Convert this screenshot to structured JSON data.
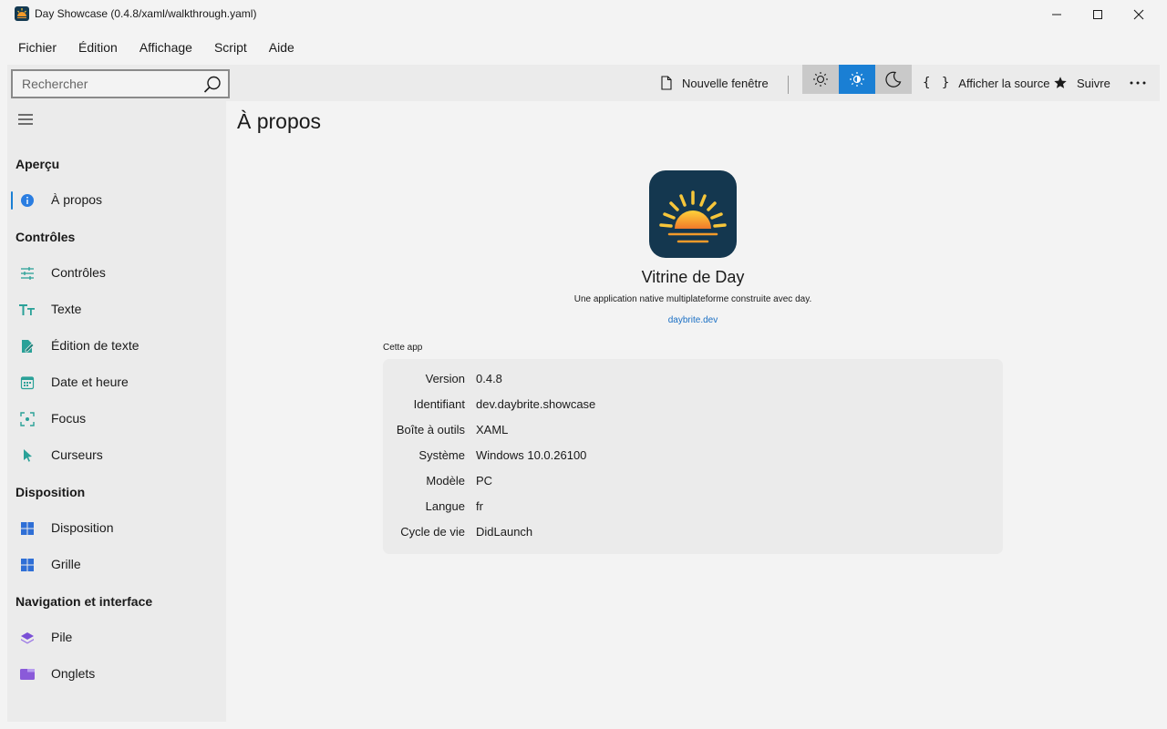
{
  "window": {
    "title": "Day Showcase (0.4.8/xaml/walkthrough.yaml)",
    "controls": [
      "minimize-icon",
      "maximize-icon",
      "close-icon"
    ]
  },
  "menu": [
    "Fichier",
    "Édition",
    "Affichage",
    "Script",
    "Aide"
  ],
  "toolbar": {
    "search_placeholder": "Rechercher",
    "new_window": "Nouvelle fenêtre",
    "view_source": "Afficher la source",
    "follow": "Suivre",
    "theme_selected": "auto",
    "accent": "#1a7fd4"
  },
  "sidebar": {
    "sections": [
      {
        "title": "Aperçu",
        "items": [
          {
            "label": "À propos",
            "icon": "info-icon",
            "selected": true
          }
        ]
      },
      {
        "title": "Contrôles",
        "items": [
          {
            "label": "Contrôles",
            "icon": "sliders-icon"
          },
          {
            "label": "Texte",
            "icon": "text-size-icon"
          },
          {
            "label": "Édition de texte",
            "icon": "edit-document-icon"
          },
          {
            "label": "Date et heure",
            "icon": "calendar-icon"
          },
          {
            "label": "Focus",
            "icon": "focus-icon"
          },
          {
            "label": "Curseurs",
            "icon": "cursor-icon"
          }
        ]
      },
      {
        "title": "Disposition",
        "items": [
          {
            "label": "Disposition",
            "icon": "layout-icon"
          },
          {
            "label": "Grille",
            "icon": "grid-icon"
          }
        ]
      },
      {
        "title": "Navigation et interface",
        "items": [
          {
            "label": "Pile",
            "icon": "stack-icon"
          },
          {
            "label": "Onglets",
            "icon": "tabs-icon"
          }
        ]
      }
    ]
  },
  "main": {
    "page_title": "À propos",
    "app_name": "Vitrine de Day",
    "app_description": "Une application native multiplateforme construite avec day.",
    "app_link": "daybrite.dev",
    "section_label": "Cette app",
    "info": [
      {
        "key": "Version",
        "value": "0.4.8"
      },
      {
        "key": "Identifiant",
        "value": "dev.daybrite.showcase"
      },
      {
        "key": "Boîte à outils",
        "value": "XAML"
      },
      {
        "key": "Système",
        "value": "Windows 10.0.26100"
      },
      {
        "key": "Modèle",
        "value": "PC"
      },
      {
        "key": "Langue",
        "value": "fr"
      },
      {
        "key": "Cycle de vie",
        "value": "DidLaunch"
      }
    ]
  }
}
